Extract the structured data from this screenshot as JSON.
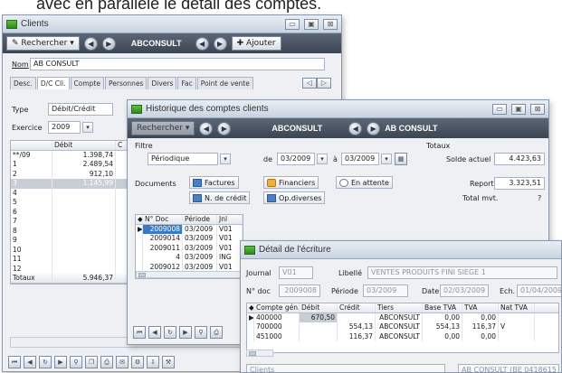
{
  "heading": "avec en parallèle le détail des comptes.",
  "clients": {
    "title": "Clients",
    "search_label": "Rechercher",
    "company": "ABCONSULT",
    "add_label": "Ajouter",
    "nom_label": "Nom",
    "nom_value": "AB CONSULT",
    "tabs": [
      "Desc.",
      "D/C Cli.",
      "Compte",
      "Personnes",
      "Divers",
      "Fac",
      "Point de vente"
    ],
    "type_label": "Type",
    "type_value": "Débit/Crédit",
    "exercice_label": "Exercice",
    "exercice_value": "2009",
    "columns": [
      "",
      "Débit",
      "C"
    ],
    "rows": [
      [
        "**/09",
        "1.398,74"
      ],
      [
        "1",
        "2.489,54"
      ],
      [
        "2",
        "912,10"
      ],
      [
        "3",
        "1.145,99"
      ],
      [
        "4",
        ""
      ],
      [
        "5",
        ""
      ],
      [
        "6",
        ""
      ],
      [
        "7",
        ""
      ],
      [
        "8",
        ""
      ],
      [
        "9",
        ""
      ],
      [
        "10",
        ""
      ],
      [
        "11",
        ""
      ],
      [
        "12",
        ""
      ]
    ],
    "totals_label": "Totaux",
    "totals_value": "5.946,37"
  },
  "historique": {
    "title": "Historique des comptes clients",
    "search_label": "Rechercher",
    "company": "ABCONSULT",
    "company_right": "AB CONSULT",
    "filtre_label": "Filtre",
    "periode_value": "Périodique",
    "de_label": "de",
    "from_value": "03/2009",
    "a_label": "à",
    "to_value": "03/2009",
    "documents_label": "Documents",
    "factures_label": "Factures",
    "financiers_label": "Financiers",
    "en_attente_label": "En attente",
    "n_credit_label": "N. de crédit",
    "op_diverses_label": "Op.diverses",
    "totaux_label": "Totaux",
    "solde_label": "Solde actuel",
    "solde_value": "4.423,63",
    "report_label": "Report",
    "report_value": "3.323,51",
    "total_mvt_label": "Total mvt.",
    "total_mvt_value": "?",
    "columns": [
      "N° Doc",
      "Période",
      "Jnl"
    ],
    "rows": [
      [
        "2009008",
        "03/2009",
        "V01"
      ],
      [
        "2009014",
        "03/2009",
        "V01"
      ],
      [
        "2009011",
        "03/2009",
        "V01"
      ],
      [
        "4",
        "03/2009",
        "ING"
      ],
      [
        "2009012",
        "03/2009",
        "V01"
      ]
    ]
  },
  "detail": {
    "title": "Détail de l'écriture",
    "journal_label": "Journal",
    "journal_value": "V01",
    "libelle_label": "Libellé",
    "libelle_value": "VENTES PRODUITS FINI SIEGE 1",
    "ndoc_label": "N° doc",
    "ndoc_value": "2009008",
    "periode_label": "Période",
    "periode_value": "03/2009",
    "date_label": "Date",
    "date_value": "02/03/2009",
    "ech_label": "Ech.",
    "ech_value": "01/04/2009",
    "columns": [
      "Compte gén.",
      "Débit",
      "Crédit",
      "Tiers",
      "Base TVA",
      "TVA",
      "Nat TVA"
    ],
    "rows": [
      [
        "400000",
        "670,50",
        "",
        "ABCONSULT",
        "0,00",
        "0,00",
        ""
      ],
      [
        "700000",
        "",
        "554,13",
        "ABCONSULT",
        "554,13",
        "116,37",
        "V"
      ],
      [
        "451000",
        "",
        "116,37",
        "ABCONSULT",
        "0,00",
        "0,00",
        ""
      ]
    ],
    "footer_left": "Clients",
    "footer_right": "AB CONSULT (BE 0418615"
  }
}
